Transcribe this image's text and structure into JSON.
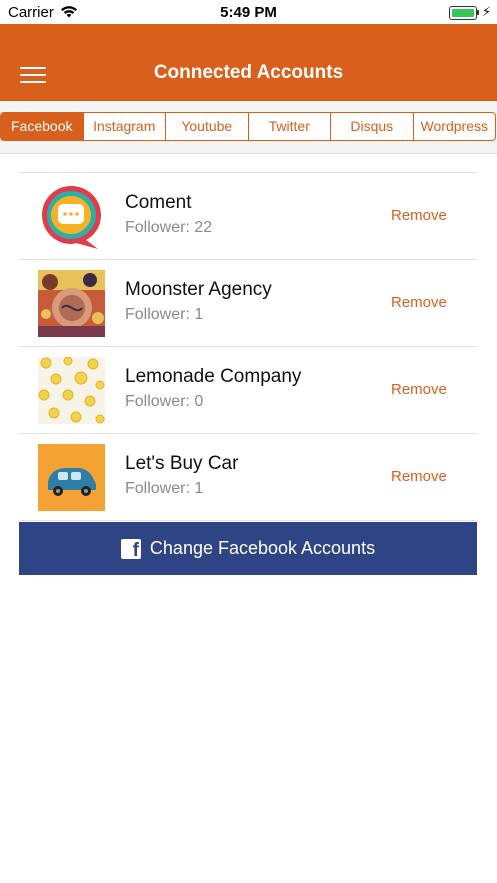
{
  "status_bar": {
    "carrier": "Carrier",
    "time": "5:49 PM"
  },
  "header": {
    "title": "Connected Accounts"
  },
  "tabs": [
    {
      "label": "Facebook",
      "active": true
    },
    {
      "label": "Instagram",
      "active": false
    },
    {
      "label": "Youtube",
      "active": false
    },
    {
      "label": "Twitter",
      "active": false
    },
    {
      "label": "Disqus",
      "active": false
    },
    {
      "label": "Wordpress",
      "active": false
    }
  ],
  "accounts": [
    {
      "name": "Coment",
      "followers": "Follower: 22",
      "action": "Remove",
      "icon": "chat-bubble-logo"
    },
    {
      "name": "Moonster Agency",
      "followers": "Follower: 1",
      "action": "Remove",
      "icon": "illustration-avatar"
    },
    {
      "name": "Lemonade Company",
      "followers": "Follower: 0",
      "action": "Remove",
      "icon": "lemon-pattern-avatar"
    },
    {
      "name": "Let's Buy Car",
      "followers": "Follower: 1",
      "action": "Remove",
      "icon": "car-avatar"
    }
  ],
  "change_button": {
    "label": "Change Facebook Accounts",
    "icon": "facebook-icon"
  },
  "colors": {
    "accent": "#d9601c",
    "facebook": "#2e4485",
    "battery": "#34c759"
  }
}
